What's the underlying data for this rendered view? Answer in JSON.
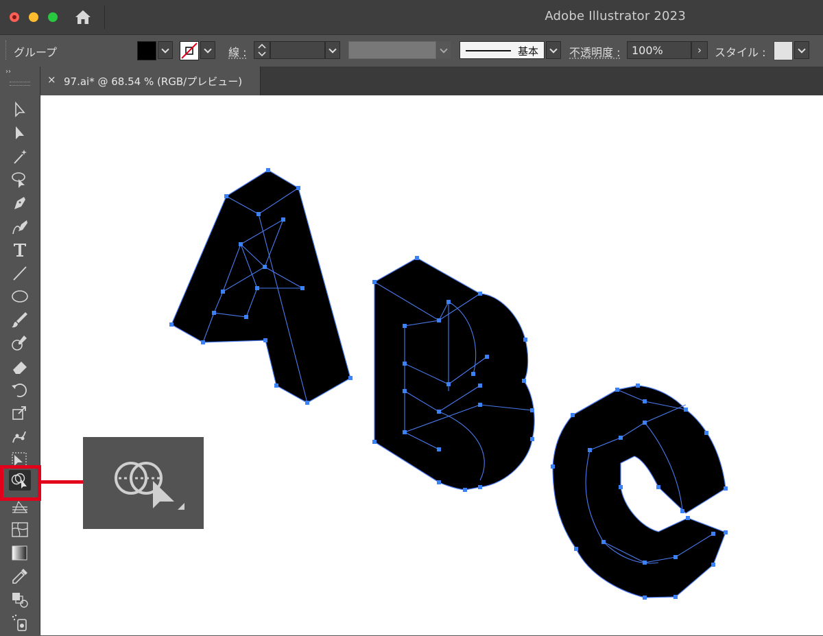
{
  "window": {
    "app_title": "Adobe Illustrator 2023"
  },
  "control_bar": {
    "selection_label": "グループ",
    "stroke_label": "線 :",
    "stroke_style_label": "基本",
    "opacity_label": "不透明度 :",
    "opacity_value": "100%",
    "style_label": "スタイル :",
    "fill_color": "#000000",
    "stroke_color": "none"
  },
  "toolbar": {
    "header": "››",
    "tools": [
      "selection-tool-icon",
      "direct-selection-tool-icon",
      "magic-wand-tool-icon",
      "lasso-tool-icon",
      "pen-tool-icon",
      "curvature-tool-icon",
      "type-tool-icon",
      "line-segment-tool-icon",
      "ellipse-tool-icon",
      "paintbrush-tool-icon",
      "shaper-tool-icon",
      "eraser-tool-icon",
      "rotate-tool-icon",
      "scale-tool-icon",
      "puppet-warp-tool-icon",
      "free-transform-tool-icon",
      "shape-builder-tool-icon",
      "perspective-grid-tool-icon",
      "mesh-tool-icon",
      "gradient-tool-icon",
      "eyedropper-tool-icon",
      "blend-tool-icon",
      "symbol-sprayer-tool-icon"
    ],
    "active_tool": "shape-builder-tool-icon"
  },
  "document_tab": {
    "close": "×",
    "title": "97.ai* @ 68.54 % (RGB/プレビュー)"
  },
  "annotation": {
    "highlight_color": "#e3001b"
  },
  "selection": {
    "anchor_color": "#3b82f6"
  }
}
